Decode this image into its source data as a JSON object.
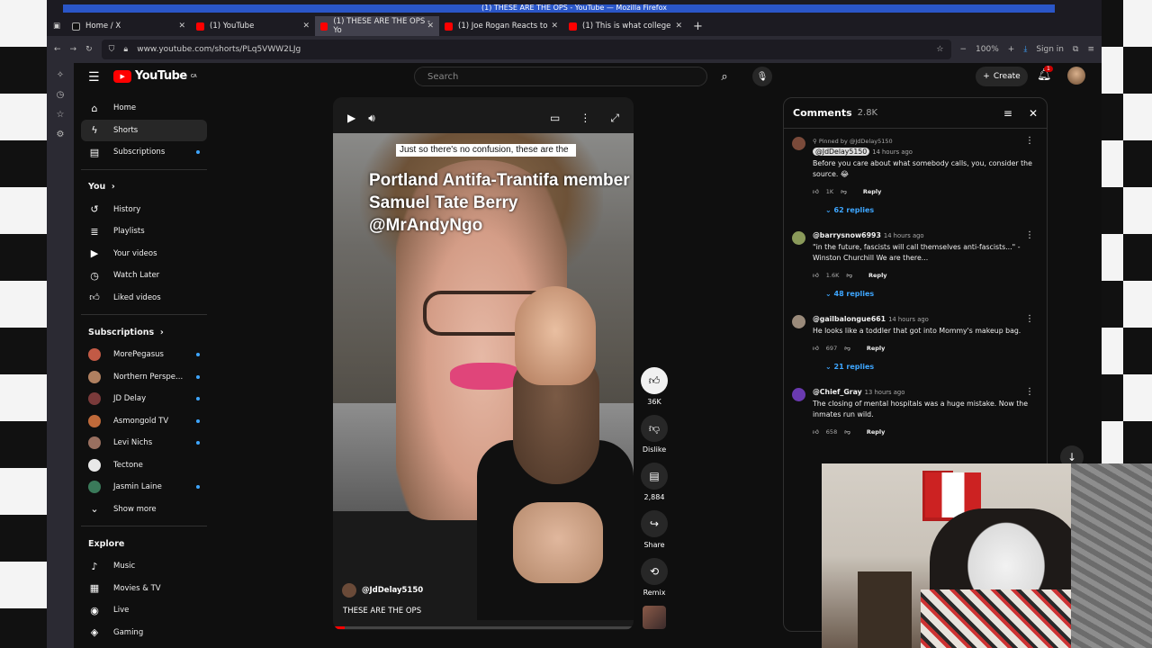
{
  "window_title": "(1) THESE ARE THE OPS - YouTube — Mozilla Firefox",
  "tabs": [
    {
      "label": "Home / X",
      "fav": "#111"
    },
    {
      "label": "(1) YouTube",
      "fav": "#f00"
    },
    {
      "label": "(1) THESE ARE THE OPS - Yo",
      "fav": "#f00"
    },
    {
      "label": "(1) Joe Rogan Reacts to",
      "fav": "#f00"
    },
    {
      "label": "(1) This is what college",
      "fav": "#f00"
    }
  ],
  "url": "www.youtube.com/shorts/PLq5VWW2LJg",
  "zoom": "100%",
  "sign_in": "Sign in",
  "header": {
    "logo": "YouTube",
    "logo_region": "CA",
    "search_placeholder": "Search",
    "create": "Create",
    "notif_count": "1"
  },
  "sidebar": {
    "main": [
      "Home",
      "Shorts",
      "Subscriptions"
    ],
    "you_heading": "You",
    "you": [
      "History",
      "Playlists",
      "Your videos",
      "Watch Later",
      "Liked videos"
    ],
    "subs_heading": "Subscriptions",
    "subs": [
      {
        "name": "MorePegasus",
        "color": "#c25a45",
        "dot": true
      },
      {
        "name": "Northern Perspe...",
        "color": "#b08060",
        "dot": true
      },
      {
        "name": "JD Delay",
        "color": "#7a3a3a",
        "dot": true
      },
      {
        "name": "Asmongold TV",
        "color": "#c06a3a",
        "dot": true
      },
      {
        "name": "Levi Nichs",
        "color": "#9a7060",
        "dot": true
      },
      {
        "name": "Tectone",
        "color": "#e8e8e8",
        "dot": false
      },
      {
        "name": "Jasmin Laine",
        "color": "#3a7a5a",
        "dot": true
      }
    ],
    "show_more": "Show more",
    "explore_heading": "Explore",
    "explore": [
      "Music",
      "Movies & TV",
      "Live",
      "Gaming"
    ]
  },
  "video": {
    "caption": "Just so there's no confusion, these are the",
    "overlay": "Portland Antifa-Trantifa member Samuel Tate Berry @MrAndyNgo",
    "channel": "@JdDelay5150",
    "title": "THESE ARE THE OPS",
    "progress": 0.04
  },
  "actions": {
    "likes": "36K",
    "dislike": "Dislike",
    "comments": "2,884",
    "share": "Share",
    "remix": "Remix"
  },
  "comments": {
    "heading": "Comments",
    "count": "2.8K",
    "items": [
      {
        "pinned": "Pinned by @JdDelay5150",
        "handle": "@JdDelay5150",
        "chip": true,
        "time": "14 hours ago",
        "text": "Before you care about what somebody calls, you, consider the source. 😂",
        "likes": "1K",
        "replies": "62 replies",
        "color": "#7a4a3a"
      },
      {
        "pinned": "",
        "handle": "@barrysnow6993",
        "chip": false,
        "time": "14 hours ago",
        "text": "\"in the future, fascists will call themselves anti-fascists...\" -Winston Churchill We are there...",
        "likes": "1.6K",
        "replies": "48 replies",
        "color": "#8a9a5a"
      },
      {
        "pinned": "",
        "handle": "@gailbalongue661",
        "chip": false,
        "time": "14 hours ago",
        "text": "He looks like a toddler that got into Mommy's makeup bag.",
        "likes": "697",
        "replies": "21 replies",
        "color": "#9a8a7a"
      },
      {
        "pinned": "",
        "handle": "@Chief_Gray",
        "chip": false,
        "time": "13 hours ago",
        "text": "The closing of mental hospitals was a huge mistake.  Now the inmates run wild.",
        "likes": "658",
        "replies": "",
        "color": "#6a3ab0"
      }
    ],
    "reply_label": "Reply"
  }
}
